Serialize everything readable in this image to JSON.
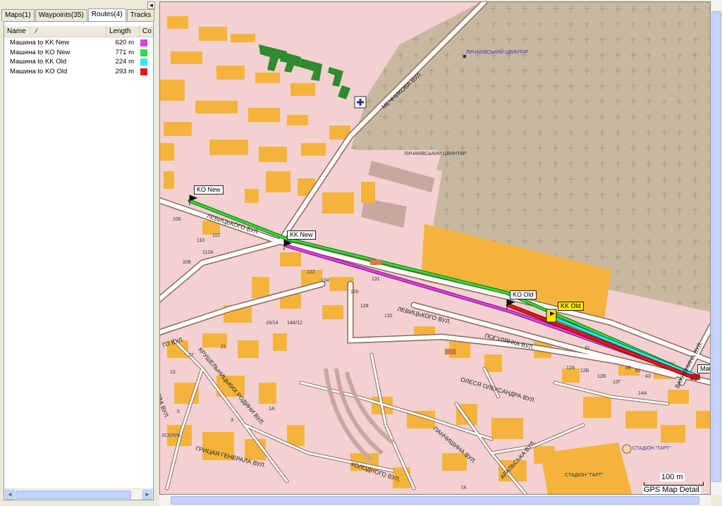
{
  "sidebar": {
    "collapse_glyph": "◄",
    "tabs": [
      {
        "label": "Maps(1)",
        "active": false
      },
      {
        "label": "Waypoints(35)",
        "active": false
      },
      {
        "label": "Routes(4)",
        "active": true
      },
      {
        "label": "Tracks",
        "active": false
      }
    ],
    "columns": {
      "name": "Name",
      "sort_glyph": "⁄",
      "length": "Length",
      "color": "Co"
    },
    "routes": [
      {
        "name": "Машина to KK New",
        "length": "620 m",
        "color": "#e040e0"
      },
      {
        "name": "Машина to KO New",
        "length": "771 m",
        "color": "#30e030"
      },
      {
        "name": "Машина to KK Old",
        "length": "224 m",
        "color": "#30e8f0"
      },
      {
        "name": "Машина to KO Old",
        "length": "293 m",
        "color": "#e01818"
      }
    ]
  },
  "map": {
    "flags": {
      "ko_new": "KO New",
      "kk_new": "KK New",
      "ko_old": "KO Old",
      "kk_old": "KK Old",
      "car": "Маш"
    },
    "streets": {
      "mechnikova": "МЕЧНИКОВА ВУЛ.",
      "levytskoho1": "ЛЕВИЦЬКОГО ВУЛ.",
      "levytskoho2": "ЛЕВИЦЬКОГО ВУЛ.",
      "pohulianka": "ПОГУЛЯНКА ВУЛ.",
      "olesia": "ОЛЕСЯ ОЛЕКСАНДРА ВУЛ.",
      "krushelnytskykh": "КРУШЕЛЬНИЦЬКИХ РОДИНИ ВУЛ.",
      "hrytsai": "ГРИЦАЯ ГЕНЕРАЛА ВУЛ.",
      "kholodnoho": "ХОЛОДНОГО ВУЛ.",
      "panchyshyna": "ПАНЧИШИНА ВУЛ.",
      "aralska": "АРАЛЬСЬКА ВУЛ.",
      "vakhnianyna": "ВАХНЯНИНА ВУЛ.",
      "tereshchenka": "КОВА ВУЛ.",
      "hohol": "ГО ВУЛ.",
      "sklub": "ХСКЛУБ"
    },
    "places": {
      "cemetery1": "ЛИЧАКІВСЬКИЙ ЦВИНТАР",
      "cemetery2": "ЛИЧАКІВСЬКИЙ ЦВИНТАР",
      "stadium1": "СТАДІОН \"ГАРТ\"",
      "stadium2": "СТАДІОН \"ГАРТ\""
    },
    "house_numbers": [
      "106",
      "110",
      "112",
      "112A",
      "108",
      "122",
      "124",
      "126",
      "128",
      "131",
      "132",
      "16/14",
      "14A/12",
      "21",
      "27",
      "13",
      "5",
      "1A",
      "3",
      "12A",
      "12Б",
      "12B",
      "12Г",
      "39",
      "41",
      "43",
      "31",
      "14A",
      "7A"
    ],
    "scale_label": "100 m",
    "detail_label": "GPS Map Detail"
  },
  "colors": {
    "background_pink": "#f3d1d1",
    "building_orange": "#f4b43c",
    "cemetery": "#c8b8a0",
    "road": "#ffffff",
    "road_edge": "#8b6a5c",
    "park_green": "#2e8b2e"
  }
}
